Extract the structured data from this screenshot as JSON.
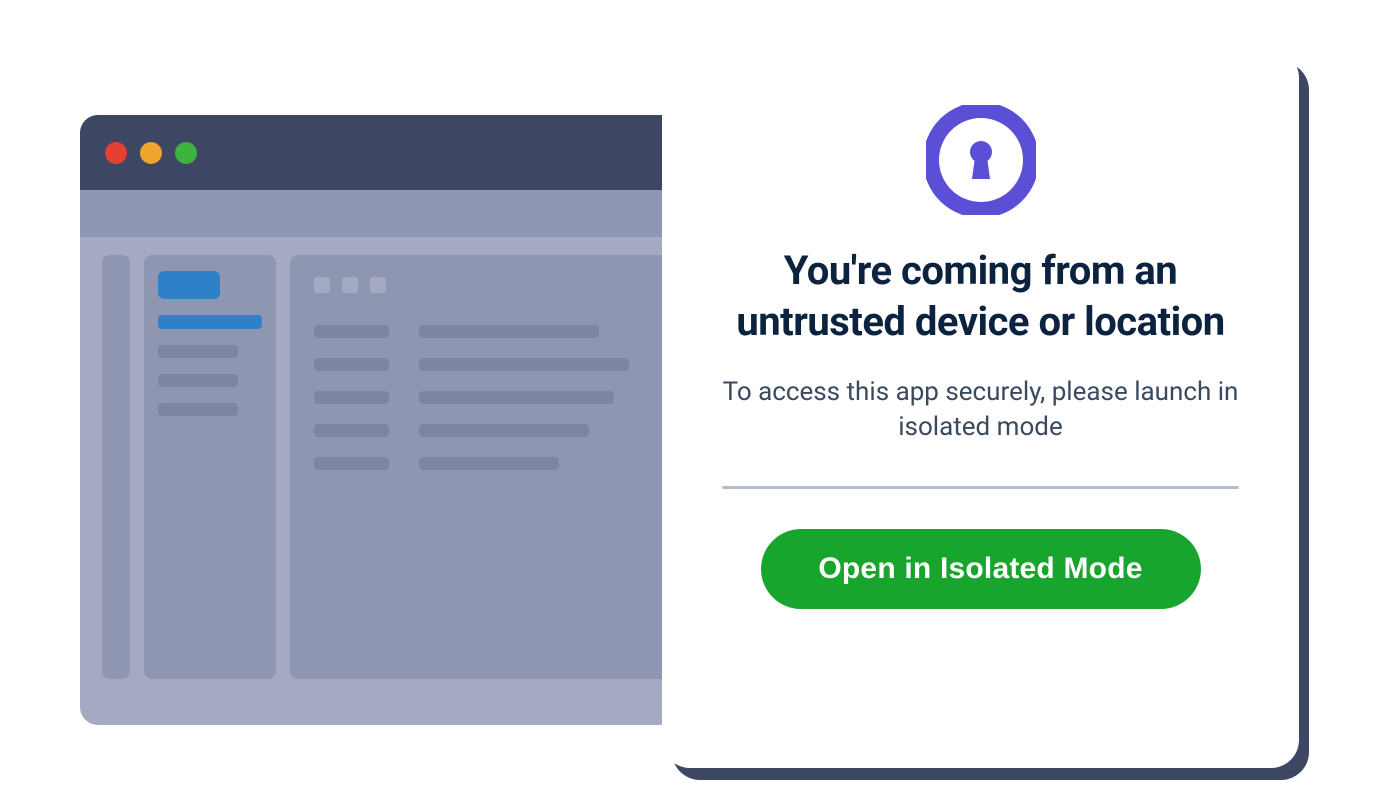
{
  "modal": {
    "heading": "You're coming from an untrusted device or location",
    "subtext": "To access this app securely, please launch in isolated mode",
    "button_label": "Open in Isolated Mode",
    "icon": "keyhole-lock-icon"
  },
  "colors": {
    "modal_shadow": "#3d4764",
    "button_green": "#18a52e",
    "icon_purple": "#5b4fd6",
    "heading_navy": "#0c2340"
  }
}
